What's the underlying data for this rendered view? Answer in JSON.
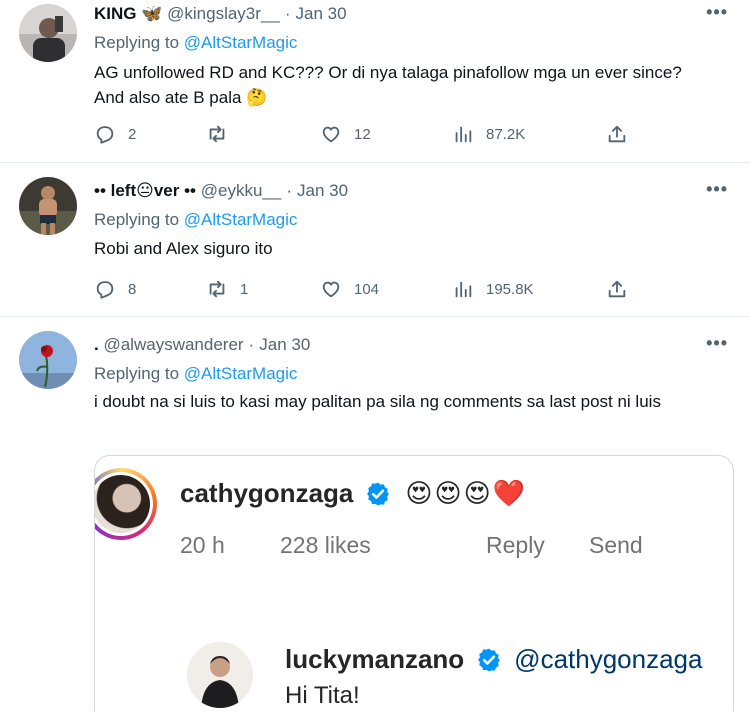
{
  "tweets": [
    {
      "name": "KING 🦋",
      "handle": "@kingslay3r__",
      "date": "Jan 30",
      "replying_prefix": "Replying to ",
      "replying_to": "@AltStarMagic",
      "text": "AG unfollowed RD and KC??? Or di nya talaga pinafollow mga un ever since? And also ate B pala 🤔",
      "replies": "2",
      "retweets": "",
      "likes": "12",
      "views": "87.2K"
    },
    {
      "name": "•• left😐ver ••",
      "handle": "@eykku__",
      "date": "Jan 30",
      "replying_prefix": "Replying to ",
      "replying_to": "@AltStarMagic",
      "text": "Robi and Alex siguro ito",
      "replies": "8",
      "retweets": "1",
      "likes": "104",
      "views": "195.8K"
    },
    {
      "name": ".",
      "handle": "@alwayswanderer",
      "date": "Jan 30",
      "replying_prefix": "Replying to ",
      "replying_to": "@AltStarMagic",
      "text": "i doubt na si luis to kasi may palitan pa sila ng comments sa last post ni luis"
    }
  ],
  "embed": {
    "comment_user": "cathygonzaga",
    "comment_emojis": "😍😍😍❤️",
    "time": "20 h",
    "likes": "228 likes",
    "reply": "Reply",
    "send": "Send",
    "reply_user": "luckymanzano",
    "reply_mention": "@cathygonzaga",
    "reply_text": "Hi Tita!"
  },
  "more_icon": "•••",
  "colors": {
    "link": "#1d9bf0",
    "muted": "#536471",
    "verified": "#0095f6"
  }
}
